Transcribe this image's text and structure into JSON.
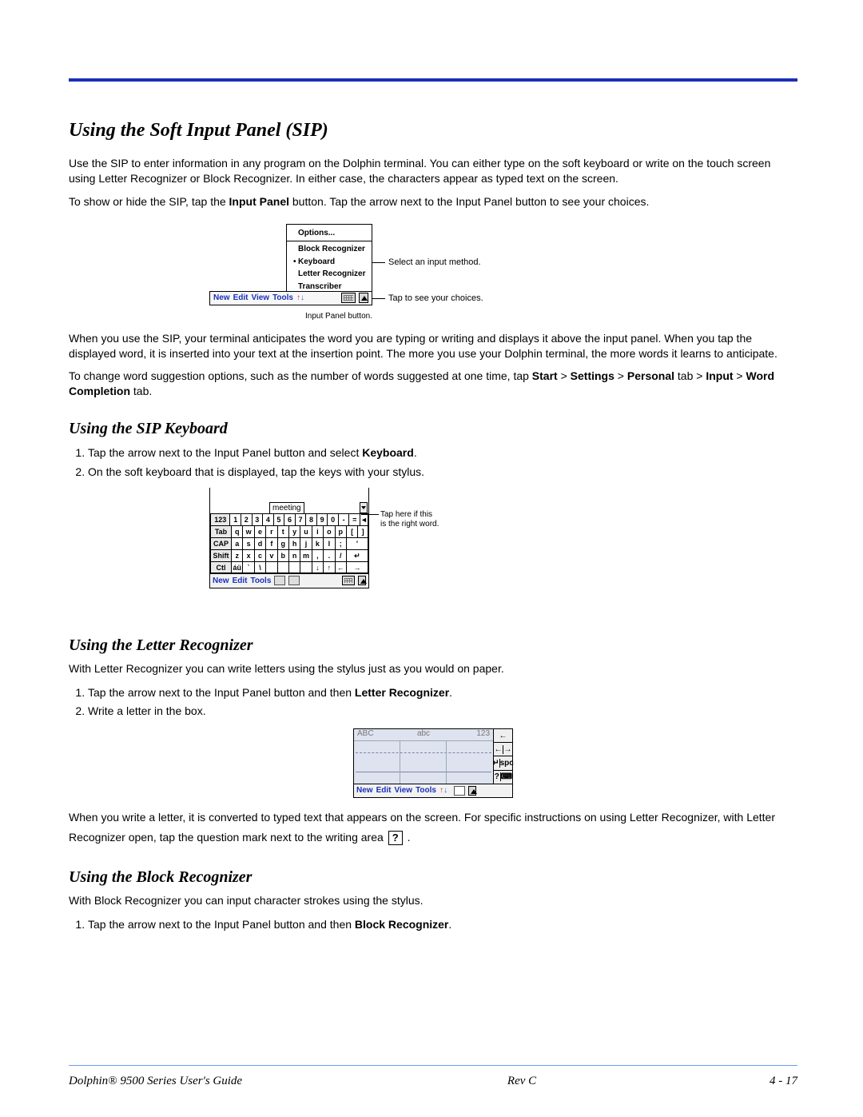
{
  "sections": {
    "sip": {
      "title": "Using the Soft Input Panel (SIP)",
      "p1": "Use the SIP to enter information in any program on the Dolphin terminal. You can either type on the soft keyboard or write on the touch screen using Letter Recognizer or Block Recognizer. In either case, the characters appear as typed text on the screen.",
      "p2a": "To show or hide the SIP, tap the ",
      "p2b": "Input Panel",
      "p2c": " button. Tap the arrow next to the Input Panel button to see your choices.",
      "p3": "When you use the SIP, your terminal anticipates the word you are typing or writing and displays it above the input panel. When you tap the displayed word, it is inserted into your text at the insertion point. The more you use your Dolphin terminal, the more words it learns to anticipate.",
      "p4a": "To change word suggestion options, such as the number of words suggested at one time, tap ",
      "p4_start": "Start",
      "p4_settings": "Settings",
      "p4_personal": "Personal",
      "p4_tab1": " tab > ",
      "p4_input": "Input",
      "p4_wc": "Word Completion",
      "p4_tab2": " tab.",
      "options_menu": {
        "options": "Options...",
        "block": "Block Recognizer",
        "keyboard": "Keyboard",
        "letter": "Letter Recognizer",
        "trans": "Transcriber"
      },
      "labels": {
        "select": "Select an input method.",
        "tap": "Tap to see your choices.",
        "ipb": "Input Panel button."
      },
      "toolbar": {
        "new": "New",
        "edit": "Edit",
        "view": "View",
        "tools": "Tools"
      }
    },
    "keyboard": {
      "title": "Using the SIP Keyboard",
      "step1a": "Tap the arrow next to the Input Panel button and select ",
      "step1b": "Keyboard",
      "step1c": ".",
      "step2": "On the soft keyboard that is displayed, tap the keys with your stylus.",
      "hint1": "Tap here if this",
      "hint2": "is the right word.",
      "suggested": "meeting",
      "rows": {
        "r1": [
          "123",
          "1",
          "2",
          "3",
          "4",
          "5",
          "6",
          "7",
          "8",
          "9",
          "0",
          "-",
          "=",
          "◄"
        ],
        "r2": [
          "Tab",
          "q",
          "w",
          "e",
          "r",
          "t",
          "y",
          "u",
          "i",
          "o",
          "p",
          "[",
          "]"
        ],
        "r3": [
          "CAP",
          "a",
          "s",
          "d",
          "f",
          "g",
          "h",
          "j",
          "k",
          "l",
          ";",
          "'"
        ],
        "r4": [
          "Shift",
          "z",
          "x",
          "c",
          "v",
          "b",
          "n",
          "m",
          ",",
          ".",
          "/",
          "↵"
        ],
        "r5": [
          "Ctl",
          "áü",
          "`",
          "\\",
          " ",
          " ",
          " ",
          " ",
          "↓",
          "↑",
          "←",
          "→"
        ]
      },
      "tb": {
        "new": "New",
        "edit": "Edit",
        "tools": "Tools"
      }
    },
    "letter": {
      "title": "Using the Letter Recognizer",
      "intro": "With Letter Recognizer you can write letters using the stylus just as you would on paper.",
      "step1a": "Tap the arrow next to the Input Panel button and then ",
      "step1b": "Letter Recognizer",
      "step1c": ".",
      "step2": "Write a letter in the box.",
      "labels": {
        "ABC": "ABC",
        "abc": "abc",
        "n123": "123"
      },
      "side": {
        "bksp": "←",
        "left": "←",
        "right": "→",
        "enter": "↵",
        "spc": "spc",
        "q": "?",
        "kbd": "⌨"
      },
      "tb": {
        "new": "New",
        "edit": "Edit",
        "view": "View",
        "tools": "Tools"
      },
      "after_a": "When you write a letter, it is converted to typed text that appears on the screen. For specific instructions on using Letter Recognizer, with Letter Recognizer open, tap the question mark next to the writing area ",
      "after_b": "."
    },
    "block": {
      "title": "Using the Block Recognizer",
      "intro": "With Block Recognizer you can input character strokes using the stylus.",
      "step1a": "Tap the arrow next to the Input Panel button and then ",
      "step1b": "Block Recognizer",
      "step1c": "."
    }
  },
  "footer": {
    "left": "Dolphin® 9500 Series User's Guide",
    "mid": "Rev C",
    "right": "4 - 17"
  }
}
